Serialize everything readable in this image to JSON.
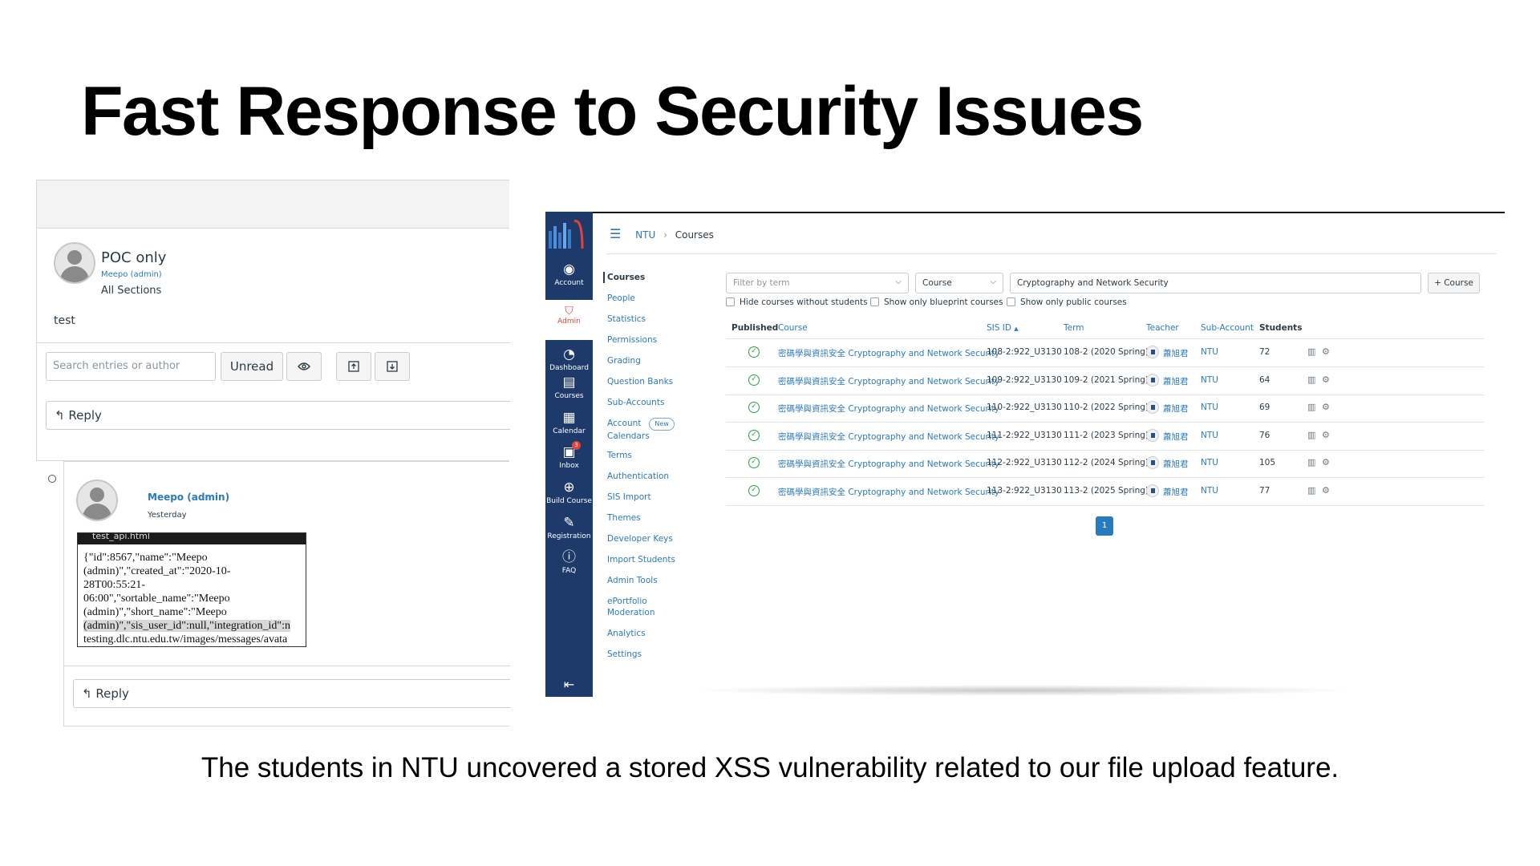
{
  "slide": {
    "title": "Fast Response to Security Issues",
    "caption": "The students in NTU uncovered a stored XSS vulnerability related to our file upload feature."
  },
  "discussion": {
    "post_title": "POC only",
    "post_author": "Meepo (admin)",
    "post_sections": "All Sections",
    "post_body": "test",
    "search_placeholder": "Search entries or author",
    "unread_label": "Unread",
    "reply_label": "Reply",
    "reply_author": "Meepo (admin)",
    "reply_time": "Yesterday",
    "popup_title": "test_api.html",
    "popup_lines": [
      "{\"id\":8567,\"name\":\"Meepo",
      "(admin)\",\"created_at\":\"2020-10-",
      "28T00:55:21-",
      "06:00\",\"sortable_name\":\"Meepo",
      "(admin)\",\"short_name\":\"Meepo",
      "(admin)\",\"sis_user_id\":null,\"integration_id\":n",
      "testing.dlc.ntu.edu.tw/images/messages/avata"
    ],
    "icons": [
      "eye-icon",
      "upload-icon",
      "download-icon",
      "reply-arrow-icon"
    ]
  },
  "admin": {
    "breadcrumb": {
      "root": "NTU",
      "current": "Courses"
    },
    "global_nav": [
      {
        "label": "Account",
        "icon": "account-icon"
      },
      {
        "label": "Admin",
        "icon": "admin-icon"
      },
      {
        "label": "Dashboard",
        "icon": "dashboard-icon"
      },
      {
        "label": "Courses",
        "icon": "courses-icon"
      },
      {
        "label": "Calendar",
        "icon": "calendar-icon"
      },
      {
        "label": "Inbox",
        "icon": "inbox-icon"
      },
      {
        "label": "Build Course",
        "icon": "plus-circle-icon"
      },
      {
        "label": "Registration",
        "icon": "edit-icon"
      },
      {
        "label": "FAQ",
        "icon": "help-icon"
      }
    ],
    "inbox_badge": "3",
    "subnav": [
      "Courses",
      "People",
      "Statistics",
      "Permissions",
      "Grading",
      "Question Banks",
      "Sub-Accounts",
      "Account",
      "Calendars",
      "Terms",
      "Authentication",
      "SIS Import",
      "Themes",
      "Developer Keys",
      "Import Students",
      "Admin Tools",
      "ePortfolio",
      "Moderation",
      "Analytics",
      "Settings"
    ],
    "new_badge": "New",
    "filters": {
      "term_placeholder": "Filter by term",
      "type_value": "Course",
      "search_value": "Cryptography and Network Security",
      "add_button": "+ Course"
    },
    "checkboxes": [
      "Hide courses without students",
      "Show only blueprint courses",
      "Show only public courses"
    ],
    "columns": [
      "Published",
      "Course",
      "SIS ID",
      "Term",
      "Teacher",
      "Sub-Account",
      "Students"
    ],
    "sort_indicator": "▲",
    "rows": [
      {
        "course": "密碼學與資訊安全 Cryptography and Network Security",
        "sis_id": "108-2:922_U3130",
        "term": "108-2 (2020 Spring)",
        "teacher": "蕭旭君",
        "sub_account": "NTU",
        "students": "72"
      },
      {
        "course": "密碼學與資訊安全 Cryptography and Network Security",
        "sis_id": "109-2:922_U3130",
        "term": "109-2 (2021 Spring)",
        "teacher": "蕭旭君",
        "sub_account": "NTU",
        "students": "64"
      },
      {
        "course": "密碼學與資訊安全 Cryptography and Network Security",
        "sis_id": "110-2:922_U3130",
        "term": "110-2 (2022 Spring)",
        "teacher": "蕭旭君",
        "sub_account": "NTU",
        "students": "69"
      },
      {
        "course": "密碼學與資訊安全 Cryptography and Network Security",
        "sis_id": "111-2:922_U3130",
        "term": "111-2 (2023 Spring)",
        "teacher": "蕭旭君",
        "sub_account": "NTU",
        "students": "76"
      },
      {
        "course": "密碼學與資訊安全 Cryptography and Network Security",
        "sis_id": "112-2:922_U3130",
        "term": "112-2 (2024 Spring)",
        "teacher": "蕭旭君",
        "sub_account": "NTU",
        "students": "105"
      },
      {
        "course": "密碼學與資訊安全 Cryptography and Network Security",
        "sis_id": "113-2:922_U3130",
        "term": "113-2 (2025 Spring)",
        "teacher": "蕭旭君",
        "sub_account": "NTU",
        "students": "77"
      }
    ],
    "page": "1",
    "colors": {
      "nav_bg": "#1d3a6b",
      "link": "#2b7abc",
      "published": "#2aa147",
      "admin_accent": "#e0443a"
    }
  }
}
